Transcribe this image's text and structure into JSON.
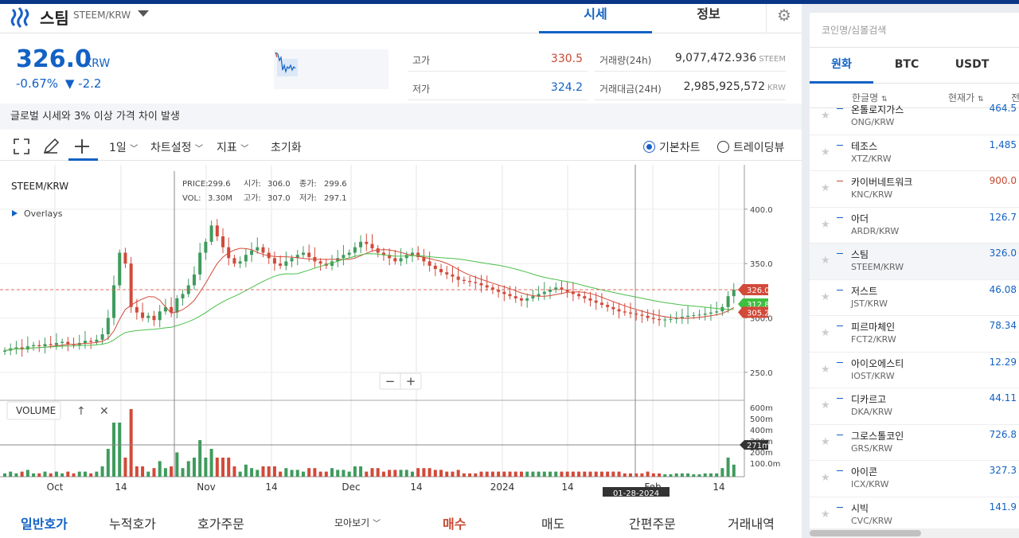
{
  "header": {
    "coin_name": "스팀",
    "coin_pair": "STEEM/KRW",
    "tab_quote": "시세",
    "tab_info": "정보"
  },
  "price": {
    "current": "326.0",
    "unit": "KRW",
    "change_pct": "-0.67%",
    "change_abs": "▼ -2.2",
    "high_label": "고가",
    "high_value": "330.5",
    "low_label": "저가",
    "low_value": "324.2",
    "volume_label": "거래량(24h)",
    "volume_value": "9,077,472.936",
    "volume_unit": "STEEM",
    "amount_label": "거래대금(24H)",
    "amount_value": "2,985,925,572",
    "amount_unit": "KRW"
  },
  "notice": "글로벌 시세와 3% 이상 가격 차이 발생",
  "toolbar": {
    "interval": "1일",
    "chart_settings": "차트설정",
    "indicators": "지표",
    "reset": "초기화",
    "basic_chart": "기본차트",
    "trading_view": "트레이딩뷰"
  },
  "chart_data": {
    "type": "candlestick",
    "symbol": "STEEM/KRW",
    "overlays_label": "Overlays",
    "info": {
      "price_label": "PRICE:",
      "price": "299.6",
      "open_label": "시가:",
      "open": "306.0",
      "close_label": "종가:",
      "close": "299.6",
      "vol_label": "VOL:",
      "vol": "3.30M",
      "high_label": "고가:",
      "high": "307.0",
      "low_label": "저가:",
      "low": "297.1"
    },
    "x_labels": [
      "Oct",
      "14",
      "Nov",
      "14",
      "Dec",
      "14",
      "2024",
      "14",
      "Feb",
      "14"
    ],
    "crosshair_date": "01-28-2024",
    "y_ticks": [
      "400.0",
      "350.0",
      "300.0",
      "250.0"
    ],
    "ylim": [
      225,
      435
    ],
    "price_tags": {
      "current": "326.0",
      "ma_green": "312.8",
      "ma_red": "305.2"
    },
    "volume_label": "VOLUME",
    "volume_ticks": [
      "600m",
      "500m",
      "400m",
      "300m",
      "200m",
      "100.0m"
    ],
    "volume_tag": "271m",
    "close": [
      270,
      272,
      273,
      271,
      274,
      275,
      274,
      276,
      275,
      277,
      278,
      276,
      275,
      277,
      279,
      278,
      280,
      285,
      300,
      330,
      360,
      350,
      310,
      305,
      300,
      302,
      298,
      306,
      310,
      305,
      318,
      322,
      330,
      340,
      360,
      370,
      385,
      375,
      365,
      355,
      350,
      352,
      358,
      362,
      365,
      360,
      355,
      350,
      348,
      352,
      355,
      358,
      360,
      356,
      352,
      350,
      348,
      352,
      355,
      358,
      360,
      365,
      370,
      368,
      364,
      360,
      358,
      355,
      352,
      355,
      358,
      360,
      356,
      352,
      348,
      345,
      342,
      340,
      338,
      335,
      334,
      333,
      332,
      330,
      328,
      326,
      324,
      322,
      320,
      318,
      316,
      318,
      320,
      322,
      324,
      326,
      328,
      326,
      324,
      322,
      320,
      318,
      316,
      314,
      312,
      310,
      308,
      306,
      305,
      304,
      303,
      302,
      300,
      299,
      298,
      298.5,
      299,
      300,
      301,
      302,
      302.5,
      303,
      304,
      305,
      306,
      310,
      320,
      326
    ]
  },
  "bottom_left_tabs": [
    "일반호가",
    "누적호가",
    "호가주문"
  ],
  "bottom_left_dropdown": "모아보기",
  "bottom_right_tabs": [
    "매수",
    "매도",
    "간편주문",
    "거래내역"
  ],
  "sidebar": {
    "search_placeholder": "코인명/심볼검색",
    "tabs": [
      "원화",
      "BTC",
      "USDT"
    ],
    "col_name": "한글명",
    "col_price": "현재가",
    "col_change": "전",
    "items": [
      {
        "name": "온톨로지가스",
        "pair": "ONG/KRW",
        "price": "464.5",
        "color": "#1261c4"
      },
      {
        "name": "테조스",
        "pair": "XTZ/KRW",
        "price": "1,485",
        "color": "#1261c4"
      },
      {
        "name": "카이버네트워크",
        "pair": "KNC/KRW",
        "price": "900.0",
        "color": "#c84a31"
      },
      {
        "name": "아더",
        "pair": "ARDR/KRW",
        "price": "126.7",
        "color": "#1261c4"
      },
      {
        "name": "스팀",
        "pair": "STEEM/KRW",
        "price": "326.0",
        "color": "#1261c4"
      },
      {
        "name": "저스트",
        "pair": "JST/KRW",
        "price": "46.08",
        "color": "#1261c4"
      },
      {
        "name": "피르마체인",
        "pair": "FCT2/KRW",
        "price": "78.34",
        "color": "#1261c4"
      },
      {
        "name": "아이오에스티",
        "pair": "IOST/KRW",
        "price": "12.29",
        "color": "#1261c4"
      },
      {
        "name": "디카르고",
        "pair": "DKA/KRW",
        "price": "44.11",
        "color": "#1261c4"
      },
      {
        "name": "그로스톨코인",
        "pair": "GRS/KRW",
        "price": "726.8",
        "color": "#1261c4"
      },
      {
        "name": "아이콘",
        "pair": "ICX/KRW",
        "price": "327.3",
        "color": "#1261c4"
      },
      {
        "name": "시빅",
        "pair": "CVC/KRW",
        "price": "141.9",
        "color": "#1261c4"
      }
    ]
  }
}
